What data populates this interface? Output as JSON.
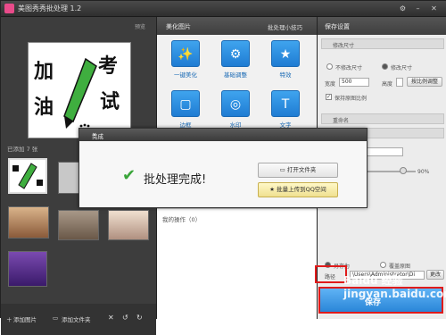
{
  "app": {
    "title": "美图秀秀批处理 1.2"
  },
  "window_buttons": {
    "settings": "⚙",
    "minimize": "–",
    "close": "✕"
  },
  "preview": {
    "label": "预览",
    "image_text": {
      "char1": "加",
      "char2": "考",
      "char3": "油",
      "char4": "试"
    }
  },
  "left": {
    "added_label": "已添加 7 张",
    "add_image": "添加图片",
    "add_folder": "添加文件夹"
  },
  "middle": {
    "title": "美化图片",
    "tips": "批处理小技巧",
    "tools": [
      {
        "label": "一键美化",
        "icon": "✨"
      },
      {
        "label": "基础调整",
        "icon": "⚙"
      },
      {
        "label": "特效",
        "icon": "★"
      },
      {
        "label": "边框",
        "icon": "▢"
      },
      {
        "label": "水印",
        "icon": "◎"
      },
      {
        "label": "文字",
        "icon": "T"
      }
    ],
    "ops_label": "我的操作（0）"
  },
  "right": {
    "title": "保存设置",
    "size_section": "修改尺寸",
    "no_resize": "不修改尺寸",
    "resize": "修改尺寸",
    "width_label": "宽度",
    "width_value": "500",
    "height_label": "高度",
    "ratio_button": "按比例调整",
    "keep_ratio": "保持原图比例",
    "rename_section": "重命名",
    "save_as": "另存为",
    "overwrite": "覆盖原图",
    "path_label": "路径",
    "path_value": "\\Users\\Administrator\\Di",
    "browse": "更改",
    "slider_value": "90%",
    "save_button": "保存"
  },
  "dialog": {
    "title": "完成",
    "message": "批处理完成!",
    "open_folder": "打开文件夹",
    "upload_qq": "批量上传到QQ空间"
  },
  "watermark": "Baidu 经验\njingyan.baidu.com"
}
